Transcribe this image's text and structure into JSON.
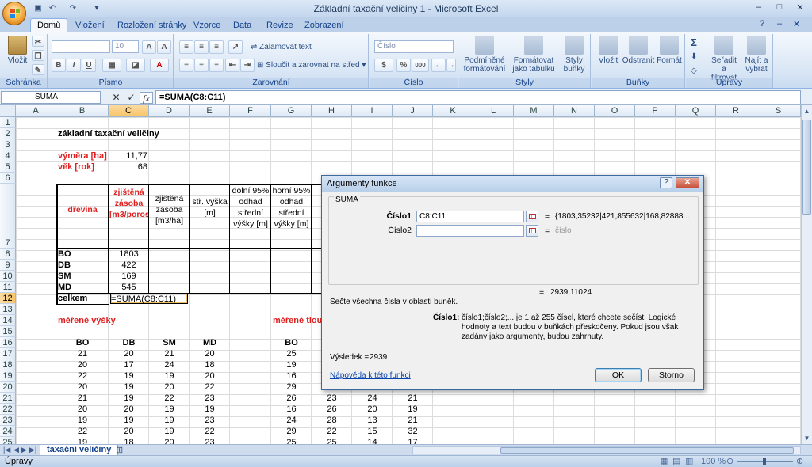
{
  "window": {
    "title": "Základní taxační veličiny 1 - Microsoft Excel",
    "controls": {
      "minimize": "–",
      "maximize": "□",
      "close": "✕"
    }
  },
  "ribbon": {
    "tabs": [
      "Domů",
      "Vložení",
      "Rozložení stránky",
      "Vzorce",
      "Data",
      "Revize",
      "Zobrazení"
    ],
    "active_tab": "Domů",
    "groups": {
      "clipboard": {
        "label": "Schránka",
        "paste": "Vložit"
      },
      "font": {
        "label": "Písmo",
        "size": "10",
        "bold": "B",
        "italic": "I",
        "underline": "U"
      },
      "alignment": {
        "label": "Zarovnání",
        "wrap": "Zalamovat text",
        "merge": "Sloučit a zarovnat na střed"
      },
      "number": {
        "label": "Číslo",
        "format": "Číslo",
        "percent": "%",
        "thousands": "000"
      },
      "styles": {
        "label": "Styly",
        "conditional": "Podmíněné formátování",
        "table": "Formátovat jako tabulku",
        "cell_styles": "Styly buňky"
      },
      "cells": {
        "label": "Buňky",
        "insert": "Vložit",
        "delete": "Odstranit",
        "format": "Formát"
      },
      "editing": {
        "label": "Úpravy",
        "sort": "Seřadit a filtrovat",
        "find": "Najít a vybrat",
        "sum_icon": "Σ"
      }
    }
  },
  "formula_bar": {
    "name_box": "SUMA",
    "cancel": "✕",
    "enter": "✓",
    "fx": "fx",
    "formula": "=SUMA(C8:C11)"
  },
  "grid": {
    "columns": [
      "A",
      "B",
      "C",
      "D",
      "E",
      "F",
      "G",
      "H",
      "I",
      "J",
      "K",
      "L",
      "M",
      "N",
      "O",
      "P",
      "Q",
      "R",
      "S"
    ],
    "rows": [
      "1",
      "2",
      "3",
      "4",
      "5",
      "6",
      "7",
      "8",
      "9",
      "10",
      "11",
      "12",
      "13",
      "14",
      "15",
      "16",
      "17",
      "18",
      "19",
      "20",
      "21",
      "22",
      "23",
      "24",
      "25"
    ],
    "selected_column": "C",
    "selected_row": "12",
    "title": "základní taxační veličiny",
    "vymera_label": "výměra [ha]",
    "vymera_value": "11,77",
    "vek_label": "věk [rok]",
    "vek_value": "68",
    "table_headers": {
      "B": "dřevina",
      "C": "zjištěná zásoba [m3/porost]",
      "D": "zjištěná zásoba [m3/ha]",
      "E": "stř. výška [m]",
      "F": "dolní 95% odhad střední výšky [m]",
      "G": "horní 95% odhad střední výšky [m]",
      "H": "st"
    },
    "species_rows": [
      {
        "name": "BO",
        "value": "1803"
      },
      {
        "name": "DB",
        "value": "422"
      },
      {
        "name": "SM",
        "value": "169"
      },
      {
        "name": "MD",
        "value": "545"
      }
    ],
    "total_label": "celkem",
    "total_formula": "=SUMA(C8:C11)",
    "measured_heights_label": "měřené výšky",
    "measured_thick_label": "měřené tlou",
    "heights_headers": [
      "BO",
      "DB",
      "SM",
      "MD"
    ],
    "heights": [
      [
        "21",
        "20",
        "21",
        "20"
      ],
      [
        "20",
        "17",
        "24",
        "18"
      ],
      [
        "22",
        "19",
        "19",
        "20"
      ],
      [
        "20",
        "19",
        "20",
        "22"
      ],
      [
        "21",
        "19",
        "22",
        "23"
      ],
      [
        "20",
        "20",
        "19",
        "19"
      ],
      [
        "19",
        "19",
        "19",
        "23"
      ],
      [
        "22",
        "20",
        "19",
        "22"
      ],
      [
        "19",
        "18",
        "20",
        "23"
      ]
    ],
    "thick_header": "BO",
    "thick_col_g": [
      "25",
      "19",
      "16",
      "29",
      "26",
      "16",
      "24",
      "29",
      "25"
    ],
    "thick_visible_rows": [
      {
        "H": "23",
        "I": "24",
        "J": "21"
      },
      {
        "H": "26",
        "I": "20",
        "J": "19"
      },
      {
        "H": "28",
        "I": "13",
        "J": "21"
      },
      {
        "H": "22",
        "I": "15",
        "J": "32"
      },
      {
        "H": "25",
        "I": "14",
        "J": "17"
      }
    ]
  },
  "sheet_tabs": {
    "active": "taxační veličiny"
  },
  "status_bar": {
    "mode": "Úpravy",
    "zoom": "100 %"
  },
  "dialog": {
    "title": "Argumenty funkce",
    "help": "?",
    "close": "✕",
    "function_name": "SUMA",
    "args": [
      {
        "label": "Číslo1",
        "value": "C8:C11",
        "result": "{1803,35232|421,855632|168,82888..."
      },
      {
        "label": "Číslo2",
        "value": "",
        "result": "číslo"
      }
    ],
    "eq": "=",
    "total_result": "2939,11024",
    "description": "Sečte všechna čísla v oblasti buněk.",
    "arg_help_label": "Číslo1:",
    "arg_help_text": "číslo1;číslo2;... je 1 až 255 čísel, které chcete sečíst. Logické hodnoty a text budou v buňkách přeskočeny. Pokud jsou však zadány jako argumenty, budou zahrnuty.",
    "result_label": "Výsledek =",
    "result_value": "2939",
    "help_link": "Nápověda k této funkci",
    "ok": "OK",
    "cancel": "Storno"
  },
  "colors": {
    "accent": "#15428b",
    "red_text": "#e02020",
    "selection": "#f8c468"
  }
}
